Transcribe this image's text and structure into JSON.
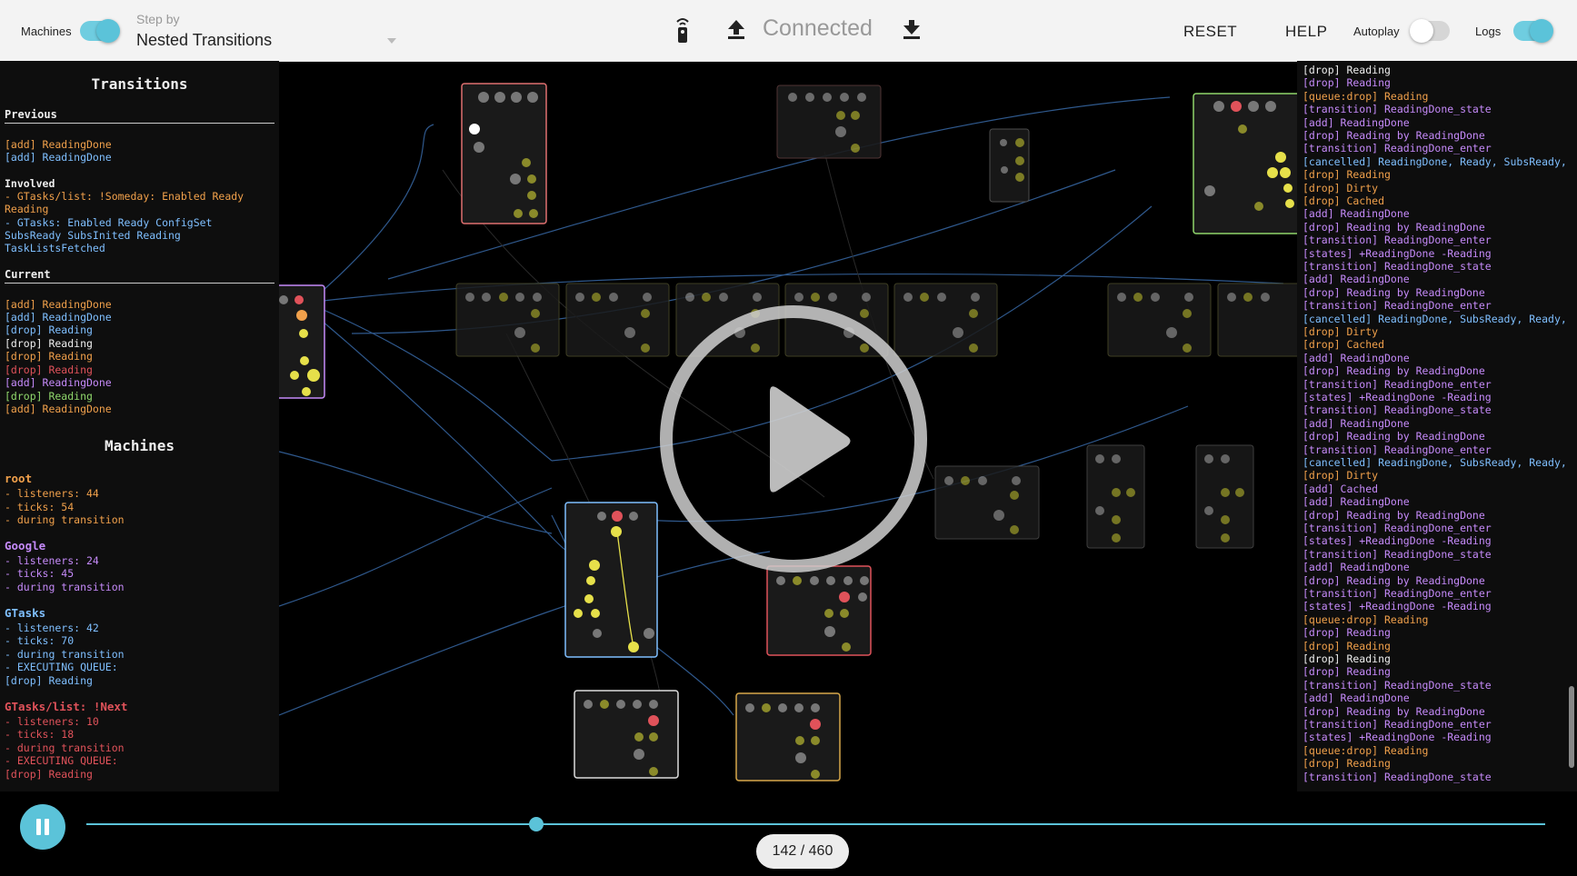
{
  "topbar": {
    "machines_label": "Machines",
    "step_by_label": "Step by",
    "step_by_value": "Nested Transitions",
    "status": "Connected",
    "reset": "RESET",
    "help": "HELP",
    "autoplay_label": "Autoplay",
    "logs_label": "Logs",
    "machines_toggle": true,
    "autoplay_toggle": false,
    "logs_toggle": true
  },
  "transitions": {
    "title": "Transitions",
    "previous_label": "Previous",
    "previous": [
      "[add] ReadingDone",
      "[add] ReadingDone"
    ],
    "involved_label": "Involved",
    "involved_1": "- GTasks/list: !Someday: Enabled Ready Reading",
    "involved_2": "- GTasks: Enabled Ready ConfigSet SubsReady SubsInited Reading TaskListsFetched",
    "current_label": "Current",
    "current": [
      "[add] ReadingDone",
      "[add] ReadingDone",
      "[drop] Reading",
      "[drop] Reading",
      "[drop] Reading",
      "[drop] Reading",
      "[add] ReadingDone",
      "[drop] Reading",
      "[add] ReadingDone"
    ]
  },
  "machines": {
    "title": "Machines",
    "list": [
      {
        "name": "root",
        "lines": [
          "- listeners: 44",
          "- ticks: 54",
          "- during transition"
        ]
      },
      {
        "name": "Google",
        "lines": [
          "- listeners: 24",
          "- ticks: 45",
          "- during transition"
        ]
      },
      {
        "name": "GTasks",
        "lines": [
          "- listeners: 42",
          "- ticks: 70",
          "- during transition",
          "- EXECUTING QUEUE:",
          "[drop] Reading"
        ]
      },
      {
        "name": "GTasks/list: !Next",
        "lines": [
          "- listeners: 10",
          "- ticks: 18",
          "- during transition",
          "- EXECUTING QUEUE:",
          "[drop] Reading"
        ]
      }
    ]
  },
  "log": [
    "[drop] Reading",
    "[drop] Reading",
    "[queue:drop] Reading",
    "[transition] ReadingDone_state",
    "[add] ReadingDone",
    "[drop] Reading by ReadingDone",
    "[transition] ReadingDone_enter",
    "[cancelled] ReadingDone, Ready, SubsReady,",
    "[drop] Reading",
    "[drop] Dirty",
    "[drop] Cached",
    "[add] ReadingDone",
    "[drop] Reading by ReadingDone",
    "[transition] ReadingDone_enter",
    "[states] +ReadingDone -Reading",
    "[transition] ReadingDone_state",
    "[add] ReadingDone",
    "[drop] Reading by ReadingDone",
    "[transition] ReadingDone_enter",
    "[cancelled] ReadingDone, SubsReady, Ready,",
    "[drop] Dirty",
    "[drop] Cached",
    "[add] ReadingDone",
    "[drop] Reading by ReadingDone",
    "[transition] ReadingDone_enter",
    "[states] +ReadingDone -Reading",
    "[transition] ReadingDone_state",
    "[add] ReadingDone",
    "[drop] Reading by ReadingDone",
    "[transition] ReadingDone_enter",
    "[cancelled] ReadingDone, SubsReady, Ready,",
    "[drop] Dirty",
    "[add] Cached",
    "[add] ReadingDone",
    "[drop] Reading by ReadingDone",
    "[transition] ReadingDone_enter",
    "[states] +ReadingDone -Reading",
    "[transition] ReadingDone_state",
    "[add] ReadingDone",
    "[drop] Reading by ReadingDone",
    "[transition] ReadingDone_enter",
    "[states] +ReadingDone -Reading",
    "[queue:drop] Reading",
    "[drop] Reading",
    "[drop] Reading",
    "[drop] Reading",
    "[drop] Reading",
    "[transition] ReadingDone_state",
    "[add] ReadingDone",
    "[drop] Reading by ReadingDone",
    "[transition] ReadingDone_enter",
    "[states] +ReadingDone -Reading",
    "[queue:drop] Reading",
    "[drop] Reading",
    "[transition] ReadingDone_state"
  ],
  "player": {
    "counter": "142 / 460",
    "position": 142,
    "total": 460
  },
  "colors": {
    "accent": "#5bc3d9",
    "orange": "#f0a04b",
    "red": "#e0525a",
    "blue": "#7fbfff",
    "purple": "#c58af9",
    "white": "#eeeeee",
    "green": "#8fd66b"
  }
}
